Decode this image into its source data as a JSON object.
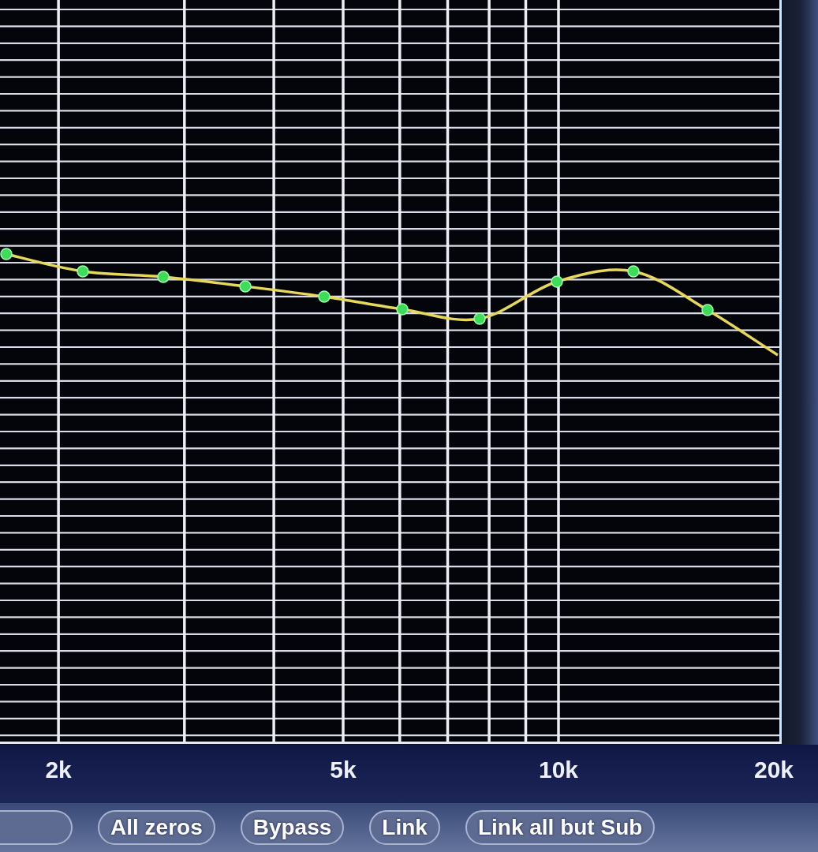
{
  "graph": {
    "x_axis_labels": [
      "2k",
      "5k",
      "10k",
      "20k"
    ]
  },
  "buttons": [
    {
      "label": "All zeros"
    },
    {
      "label": "Bypass"
    },
    {
      "label": "Link"
    },
    {
      "label": "Link all but Sub"
    }
  ]
}
